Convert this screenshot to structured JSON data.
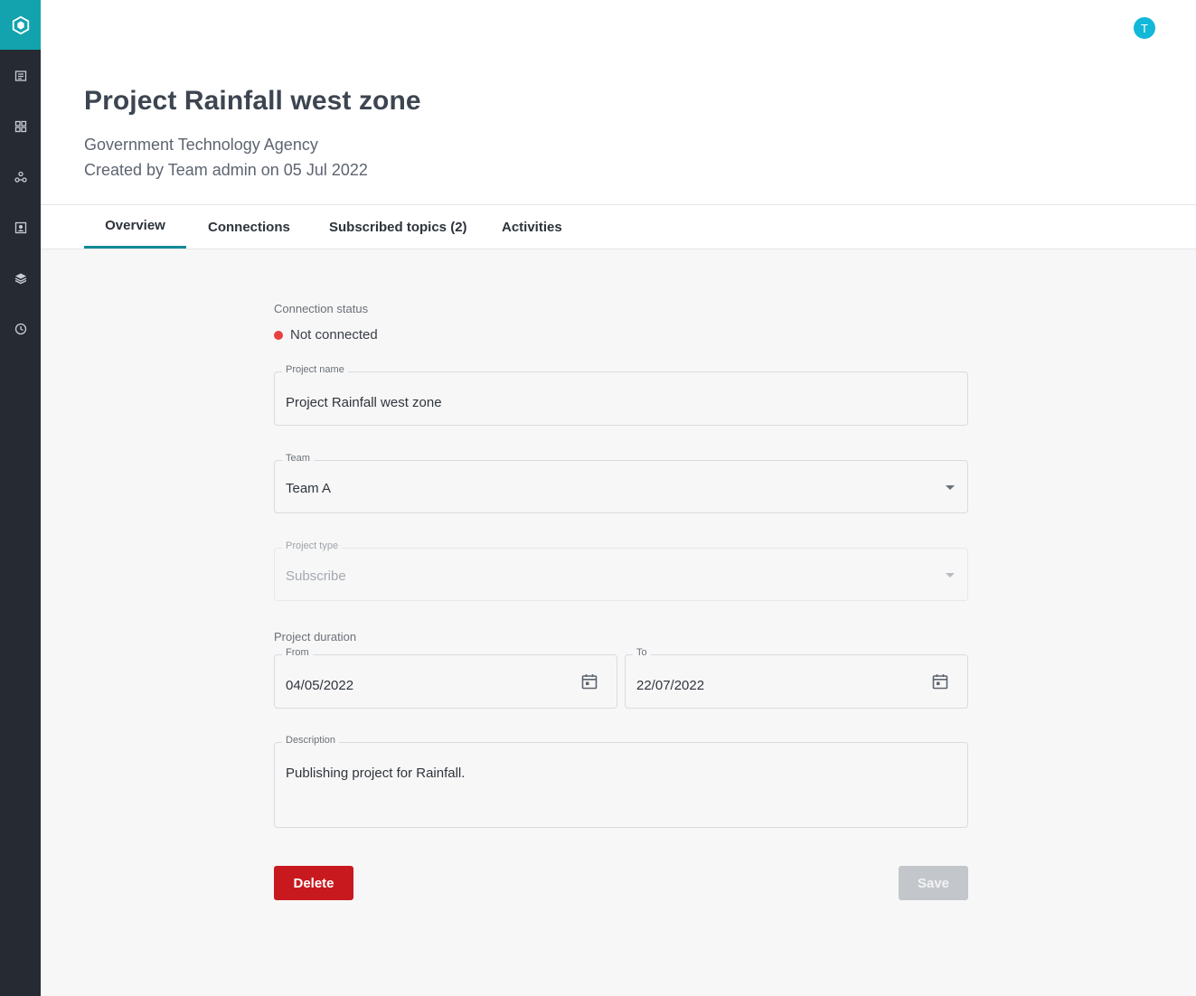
{
  "sidebar": {
    "icons": [
      "app-logo",
      "catalog-icon",
      "grid-icon",
      "network-icon",
      "contacts-icon",
      "layers-icon",
      "clock-icon"
    ]
  },
  "user": {
    "initial": "T"
  },
  "header": {
    "title": "Project Rainfall west zone",
    "organization": "Government Technology Agency",
    "created": "Created by Team admin on 05 Jul 2022"
  },
  "tabs": [
    {
      "label": "Overview",
      "active": true
    },
    {
      "label": "Connections",
      "active": false
    },
    {
      "label": "Subscribed topics (2)",
      "active": false
    },
    {
      "label": "Activities",
      "active": false
    }
  ],
  "form": {
    "connection_status_label": "Connection status",
    "connection_status": "Not connected",
    "project_name": {
      "label": "Project name",
      "value": "Project Rainfall west zone"
    },
    "team": {
      "label": "Team",
      "value": "Team A"
    },
    "project_type": {
      "label": "Project type",
      "value": "Subscribe",
      "disabled": true
    },
    "duration_label": "Project duration",
    "from": {
      "label": "From",
      "value": "04/05/2022"
    },
    "to": {
      "label": "To",
      "value": "22/07/2022"
    },
    "description": {
      "label": "Description",
      "value": "Publishing project for Rainfall."
    },
    "delete_label": "Delete",
    "save_label": "Save"
  },
  "colors": {
    "sidebar_bg": "#262b33",
    "accent": "#12a3ae",
    "tab_indicator": "#118a96",
    "status_not_connected": "#e84040",
    "delete_button": "#c8191f",
    "save_button_disabled": "#c3c6ca",
    "avatar": "#12b8d8"
  }
}
